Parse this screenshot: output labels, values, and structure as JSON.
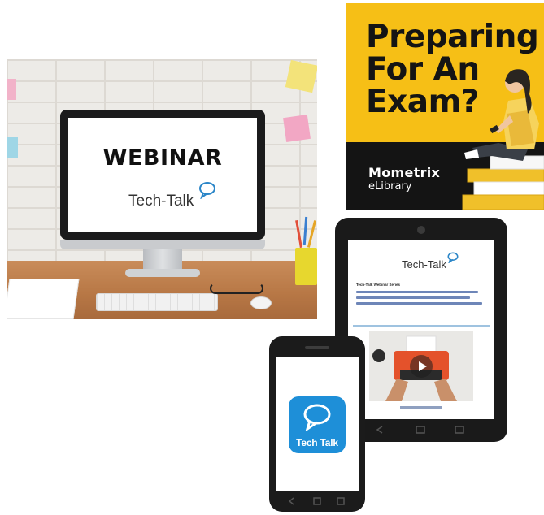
{
  "webinar": {
    "screen_title": "WEBINAR",
    "logo_text": "Tech-Talk"
  },
  "mometrix": {
    "headline_line1": "Preparing",
    "headline_line2": "For An",
    "headline_line3": "Exam?",
    "brand_name": "Mometrix",
    "brand_sub": "eLibrary"
  },
  "tablet": {
    "logo_text": "Tech-Talk",
    "article_heading": "Tech-Talk Webinar Series"
  },
  "phone": {
    "app_name": "Tech Talk"
  },
  "colors": {
    "banner_yellow": "#f6bf16",
    "banner_black": "#141414",
    "app_blue": "#1e8fd8"
  }
}
